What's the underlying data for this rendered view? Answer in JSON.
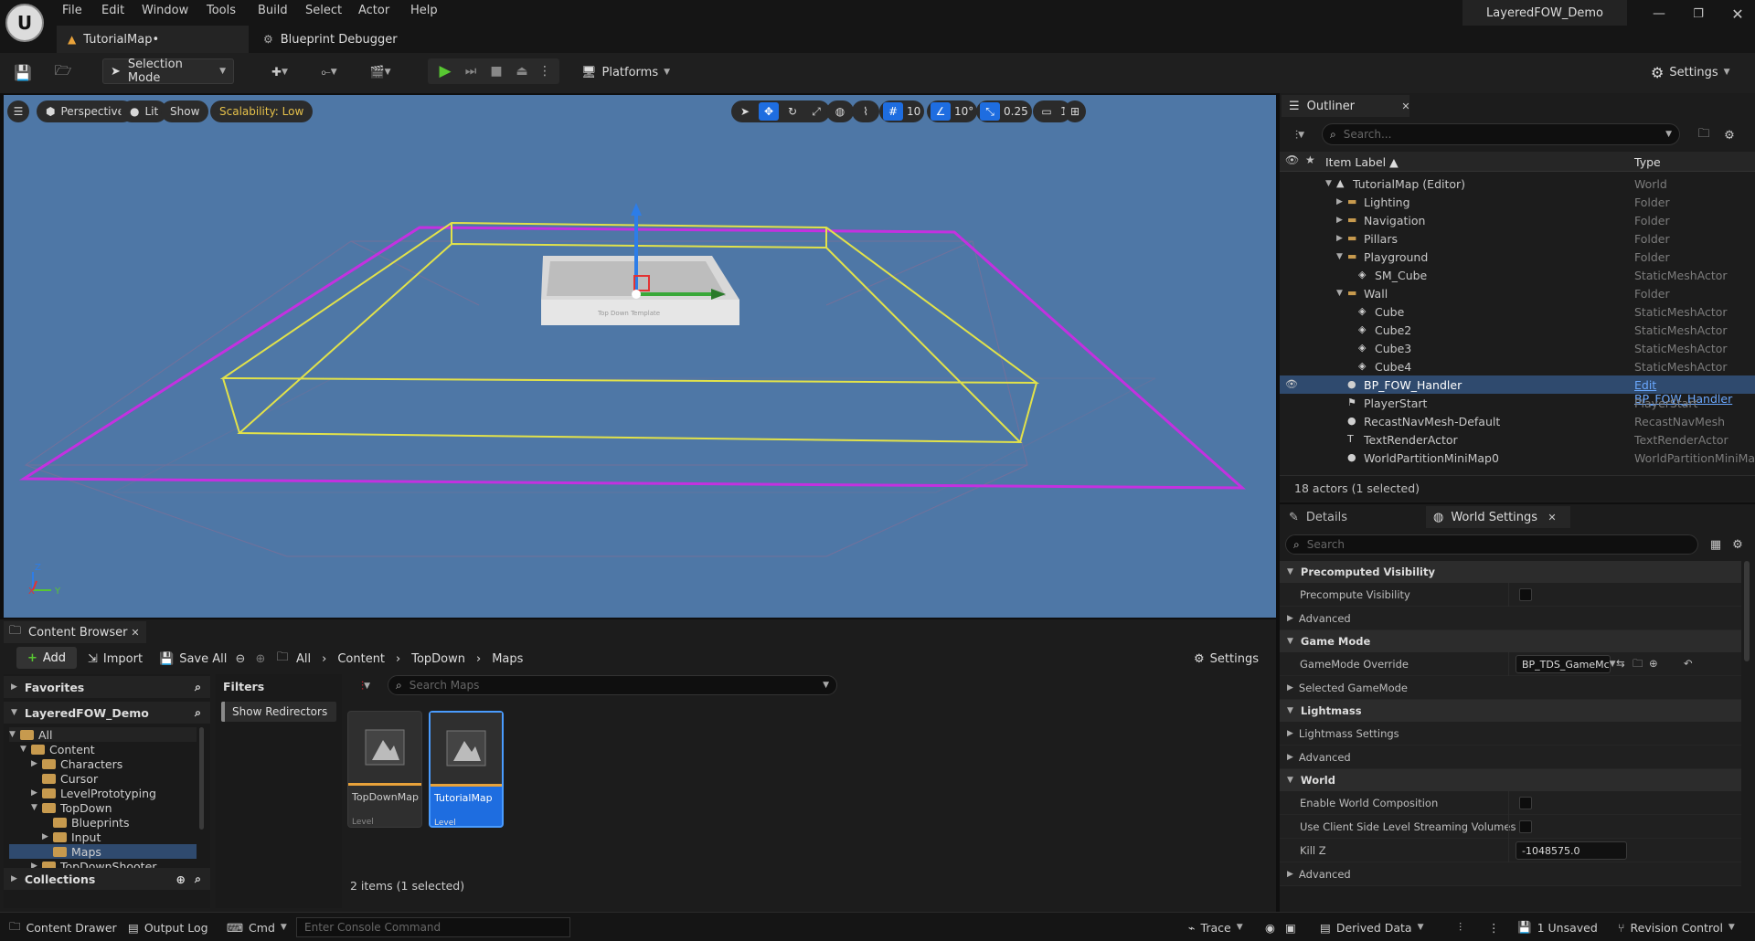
{
  "app": {
    "project_name": "LayeredFOW_Demo",
    "menu": [
      "File",
      "Edit",
      "Window",
      "Tools",
      "Build",
      "Select",
      "Actor",
      "Help"
    ]
  },
  "tabs": [
    {
      "label": "TutorialMap•",
      "active": true
    },
    {
      "label": "Blueprint Debugger",
      "active": false
    }
  ],
  "toolbar": {
    "selection_mode": "Selection Mode",
    "platforms": "Platforms",
    "settings": "Settings"
  },
  "viewport": {
    "perspective": "Perspective",
    "lit": "Lit",
    "show": "Show",
    "scalability": "Scalability: Low",
    "grid_snap": "10",
    "rotate_snap": "10°",
    "scale_snap": "0.25",
    "camera_speed": "1",
    "axis_z": "Z",
    "axis_x": "X",
    "axis_y": "Y",
    "plate_text": "Top Down Template"
  },
  "outliner": {
    "title": "Outliner",
    "search_placeholder": "Search...",
    "col_label": "Item Label ▲",
    "col_type": "Type",
    "rows": [
      {
        "label": "TutorialMap (Editor)",
        "type": "World",
        "indent": 0,
        "icon": "world-icon",
        "expander": "open"
      },
      {
        "label": "Lighting",
        "type": "Folder",
        "indent": 1,
        "icon": "folder-icon",
        "expander": "closed"
      },
      {
        "label": "Navigation",
        "type": "Folder",
        "indent": 1,
        "icon": "folder-icon",
        "expander": "closed"
      },
      {
        "label": "Pillars",
        "type": "Folder",
        "indent": 1,
        "icon": "folder-icon",
        "expander": "closed"
      },
      {
        "label": "Playground",
        "type": "Folder",
        "indent": 1,
        "icon": "folder-icon",
        "expander": "open"
      },
      {
        "label": "SM_Cube",
        "type": "StaticMeshActor",
        "indent": 2,
        "icon": "mesh-icon",
        "expander": ""
      },
      {
        "label": "Wall",
        "type": "Folder",
        "indent": 1,
        "icon": "folder-icon",
        "expander": "open"
      },
      {
        "label": "Cube",
        "type": "StaticMeshActor",
        "indent": 2,
        "icon": "mesh-icon",
        "expander": ""
      },
      {
        "label": "Cube2",
        "type": "StaticMeshActor",
        "indent": 2,
        "icon": "mesh-icon",
        "expander": ""
      },
      {
        "label": "Cube3",
        "type": "StaticMeshActor",
        "indent": 2,
        "icon": "mesh-icon",
        "expander": ""
      },
      {
        "label": "Cube4",
        "type": "StaticMeshActor",
        "indent": 2,
        "icon": "mesh-icon",
        "expander": ""
      },
      {
        "label": "BP_FOW_Handler",
        "type": "Edit BP_FOW_Handler",
        "indent": 1,
        "icon": "actor-icon",
        "expander": "",
        "selected": true
      },
      {
        "label": "PlayerStart",
        "type": "PlayerStart",
        "indent": 1,
        "icon": "player-start-icon",
        "expander": ""
      },
      {
        "label": "RecastNavMesh-Default",
        "type": "RecastNavMesh",
        "indent": 1,
        "icon": "actor-icon",
        "expander": ""
      },
      {
        "label": "TextRenderActor",
        "type": "TextRenderActor",
        "indent": 1,
        "icon": "text-render-icon",
        "expander": ""
      },
      {
        "label": "WorldPartitionMiniMap0",
        "type": "WorldPartitionMiniMa",
        "indent": 1,
        "icon": "actor-icon",
        "expander": ""
      }
    ],
    "status": "18 actors (1 selected)"
  },
  "details": {
    "tab_details": "Details",
    "tab_world_settings": "World Settings",
    "search_placeholder": "Search",
    "sections": {
      "precomputed_visibility": "Precomputed Visibility",
      "game_mode": "Game Mode",
      "lightmass": "Lightmass",
      "world": "World"
    },
    "rows": {
      "precompute_visibility": "Precompute Visibility",
      "advanced": "Advanced",
      "gamemode_override": "GameMode Override",
      "gamemode_override_value": "BP_TDS_GameMc",
      "selected_gamemode": "Selected GameMode",
      "lightmass_settings": "Lightmass Settings",
      "enable_world_composition": "Enable World Composition",
      "use_client_side": "Use Client Side Level Streaming Volumes",
      "kill_z": "Kill Z",
      "kill_z_value": "-1048575.0"
    }
  },
  "content_browser": {
    "title": "Content Browser",
    "add": "Add",
    "import": "Import",
    "save_all": "Save All",
    "breadcrumb": [
      "All",
      "Content",
      "TopDown",
      "Maps"
    ],
    "settings": "Settings",
    "favorites": "Favorites",
    "project": "LayeredFOW_Demo",
    "filters": "Filters",
    "show_redirectors": "Show Redirectors",
    "search_placeholder": "Search Maps",
    "collections": "Collections",
    "tree": [
      {
        "label": "All",
        "indent": 0,
        "expander": "open"
      },
      {
        "label": "Content",
        "indent": 1,
        "expander": "open"
      },
      {
        "label": "Characters",
        "indent": 2,
        "expander": "closed"
      },
      {
        "label": "Cursor",
        "indent": 2,
        "expander": ""
      },
      {
        "label": "LevelPrototyping",
        "indent": 2,
        "expander": "closed"
      },
      {
        "label": "TopDown",
        "indent": 2,
        "expander": "open"
      },
      {
        "label": "Blueprints",
        "indent": 3,
        "expander": ""
      },
      {
        "label": "Input",
        "indent": 3,
        "expander": "closed"
      },
      {
        "label": "Maps",
        "indent": 3,
        "expander": "",
        "selected": true
      },
      {
        "label": "TopDownShooter",
        "indent": 2,
        "expander": "closed"
      }
    ],
    "assets": [
      {
        "name": "TopDownMap",
        "type": "Level",
        "selected": false
      },
      {
        "name": "TutorialMap",
        "type": "Level",
        "selected": true
      }
    ],
    "status": "2 items (1 selected)"
  },
  "statusbar": {
    "content_drawer": "Content Drawer",
    "output_log": "Output Log",
    "cmd": "Cmd",
    "console_placeholder": "Enter Console Command",
    "trace": "Trace",
    "derived_data": "Derived Data",
    "unsaved": "1 Unsaved",
    "revision_control": "Revision Control"
  },
  "colors": {
    "accent_blue": "#1e6de0",
    "viewport_bg": "#4e77a6",
    "play_green": "#58c732",
    "selection_yellow": "#e2e24a",
    "bounds_magenta": "#c331e0"
  }
}
